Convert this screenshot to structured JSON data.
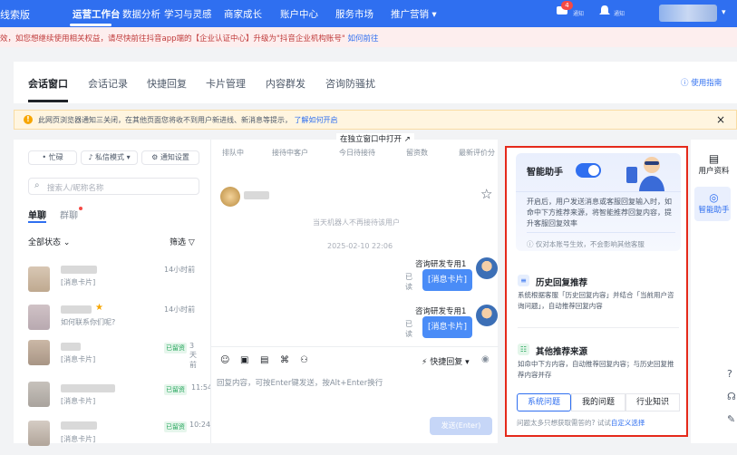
{
  "topnav": {
    "logo": "线索版",
    "items": [
      "运营工作台",
      "数据分析",
      "学习与灵感",
      "商家成长",
      "账户中心",
      "服务市场",
      "推广营销"
    ],
    "notify_badge": "4",
    "icon_labels": [
      "通知",
      "通知"
    ]
  },
  "notice": {
    "text": "效，如您想继续使用相关权益，请尽快前往抖音app端的【企业认证中心】升级为\"抖音企业机构账号\"",
    "link": "如何前往"
  },
  "tabs": {
    "items": [
      "会话窗口",
      "会话记录",
      "快捷回复",
      "卡片管理",
      "内容群发",
      "咨询防骚扰"
    ],
    "guide": "使用指南"
  },
  "warning": {
    "text": "此网页浏览器通知三关闭，在其他页面您将收不到用户新进线、新消息等提示，",
    "link": "了解如何开启"
  },
  "left": {
    "status": "• 忙碌",
    "mode": "私信模式",
    "notify_setting": "通知设置",
    "search_placeholder": "搜索人/昵称名称",
    "subtabs": [
      "单聊",
      "群聊"
    ],
    "filter_status": "全部状态",
    "filter": "筛选",
    "conversations": [
      {
        "time": "14小时前",
        "msg": "[消息卡片]",
        "tag": ""
      },
      {
        "time": "14小时前",
        "msg": "如何联系你们呢?",
        "tag": ""
      },
      {
        "time": "3天前",
        "msg": "[消息卡片]",
        "tag": "已留资"
      },
      {
        "time": "11:54",
        "msg": "[消息卡片]",
        "tag": "已留资"
      },
      {
        "time": "10:24",
        "msg": "[消息卡片]",
        "tag": "已留资"
      }
    ]
  },
  "middle": {
    "open_window": "在独立窗口中打开",
    "stats": [
      "排队中",
      "接待中客户",
      "今日待接待",
      "留资数",
      "最新评价分"
    ],
    "system_msg": "当天机器人不再接待该用户",
    "timestamp": "2025-02-10 22:06",
    "messages": [
      {
        "agent": "咨询研发专用1",
        "text": "[消息卡片]",
        "read": "已读"
      },
      {
        "agent": "咨询研发专用1",
        "text": "[消息卡片]",
        "read": "已读"
      }
    ],
    "quick_reply": "快捷回复",
    "input_placeholder": "回复内容，可按Enter键发送，按Alt+Enter换行",
    "send": "发送(Enter)"
  },
  "assistant": {
    "title": "智能助手",
    "toggle_on": true,
    "desc": "开启后，用户发送消息或客服回复输入时，如命中下方推荐来源，将智能推荐回复内容，提升客服回复效率",
    "note": "仅对本账号生效，不会影响其他客服",
    "history_title": "历史回复推荐",
    "history_desc": "系统根据客服「历史回复内容」并结合「当前用户咨询问题」，自动推荐回复内容",
    "other_title": "其他推荐来源",
    "other_desc": "如命中下方内容，自动推荐回复内容；与历史回复推荐内容并存",
    "chips": [
      "系统问题",
      "我的问题",
      "行业知识"
    ],
    "footer": "问题太多只想获取需答的? 试试",
    "footer_link": "自定义选择"
  },
  "sidebar": {
    "items": [
      "用户资料",
      "智能助手"
    ]
  },
  "colors": {
    "primary": "#2f6ff0",
    "highlight_border": "#e5291a"
  }
}
